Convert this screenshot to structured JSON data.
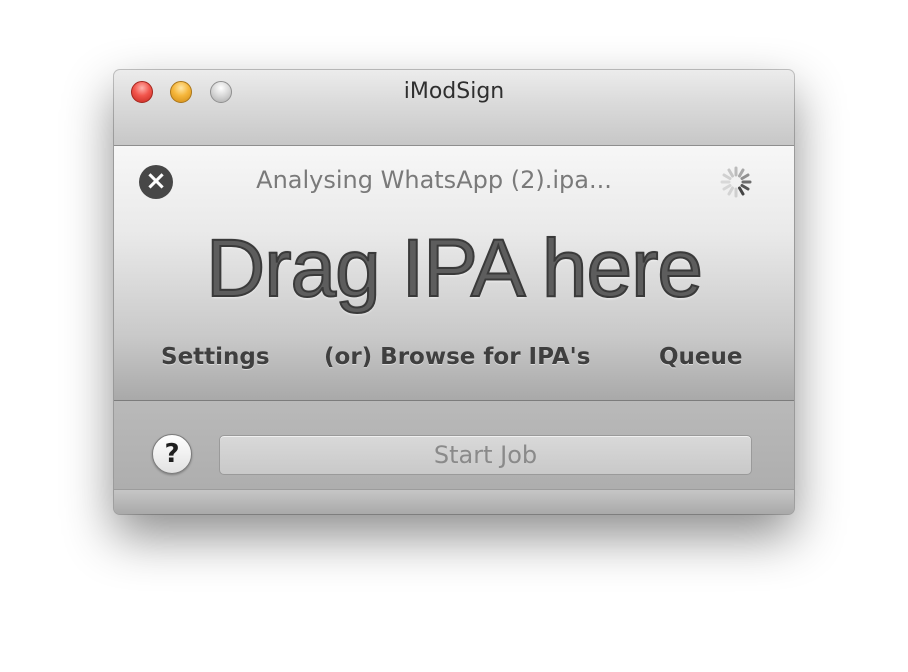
{
  "window": {
    "title": "iModSign"
  },
  "status": {
    "text": "Analysing WhatsApp (2).ipa..."
  },
  "droparea": {
    "title": "Drag IPA here",
    "links": {
      "settings": "Settings",
      "browse": "(or) Browse for IPA's",
      "queue": "Queue"
    }
  },
  "actions": {
    "help_label": "?",
    "start_label": "Start Job"
  },
  "icons": {
    "cancel": "x-circle-icon",
    "spinner": "spinner-icon"
  },
  "colors": {
    "close": "#f2564d",
    "minimize": "#f6b73c",
    "zoom": "#c8c8c8"
  }
}
